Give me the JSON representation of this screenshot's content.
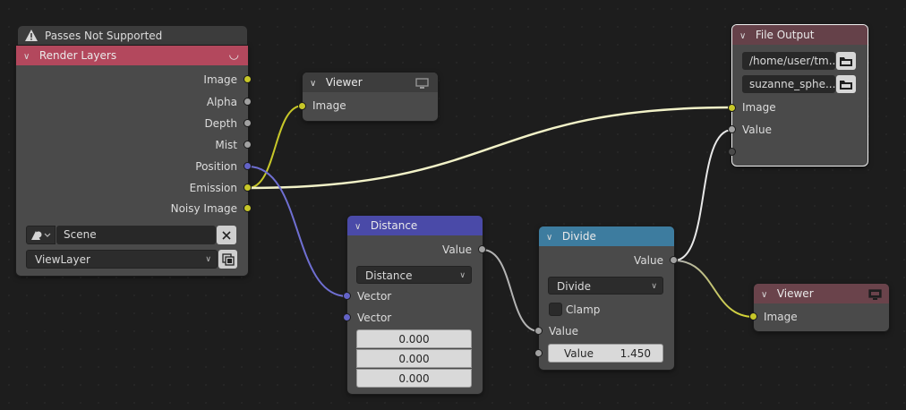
{
  "colors": {
    "render_layers_header": "#b3485d",
    "viewer_header": "#3d3d3d",
    "distance_header": "#4a4aa8",
    "divide_header": "#3d7c9f",
    "file_output_header": "#654149",
    "viewer2_header": "#6a434b",
    "socket_color": "#c7c729",
    "socket_float": "#a1a1a1",
    "socket_vector": "#6363c7"
  },
  "warning": {
    "icon": "warning-icon",
    "text": "Passes Not Supported"
  },
  "render_layers": {
    "title": "Render Layers",
    "outputs": [
      "Image",
      "Alpha",
      "Depth",
      "Mist",
      "Position",
      "Emission",
      "Noisy Image"
    ],
    "scene": {
      "icon": "scene-icon",
      "value": "Scene",
      "clear_icon": "close-icon"
    },
    "view_layer": {
      "value": "ViewLayer",
      "icon": "view-layer-icon"
    }
  },
  "viewer_top": {
    "title": "Viewer",
    "icon": "monitor-icon",
    "input": "Image"
  },
  "distance": {
    "title": "Distance",
    "output": "Value",
    "mode": "Distance",
    "inputs": [
      "Vector",
      "Vector"
    ],
    "vector_values": [
      "0.000",
      "0.000",
      "0.000"
    ]
  },
  "divide": {
    "title": "Divide",
    "output": "Value",
    "mode": "Divide",
    "clamp_label": "Clamp",
    "input_value_label": "Value",
    "value_field": {
      "label": "Value",
      "value": "1.450"
    }
  },
  "file_output": {
    "title": "File Output",
    "path1": "/home/user/tm...",
    "path2": "suzanne_sphe...",
    "inputs": [
      "Image",
      "Value"
    ]
  },
  "viewer_bottom": {
    "title": "Viewer",
    "icon": "monitor-icon",
    "input": "Image"
  }
}
